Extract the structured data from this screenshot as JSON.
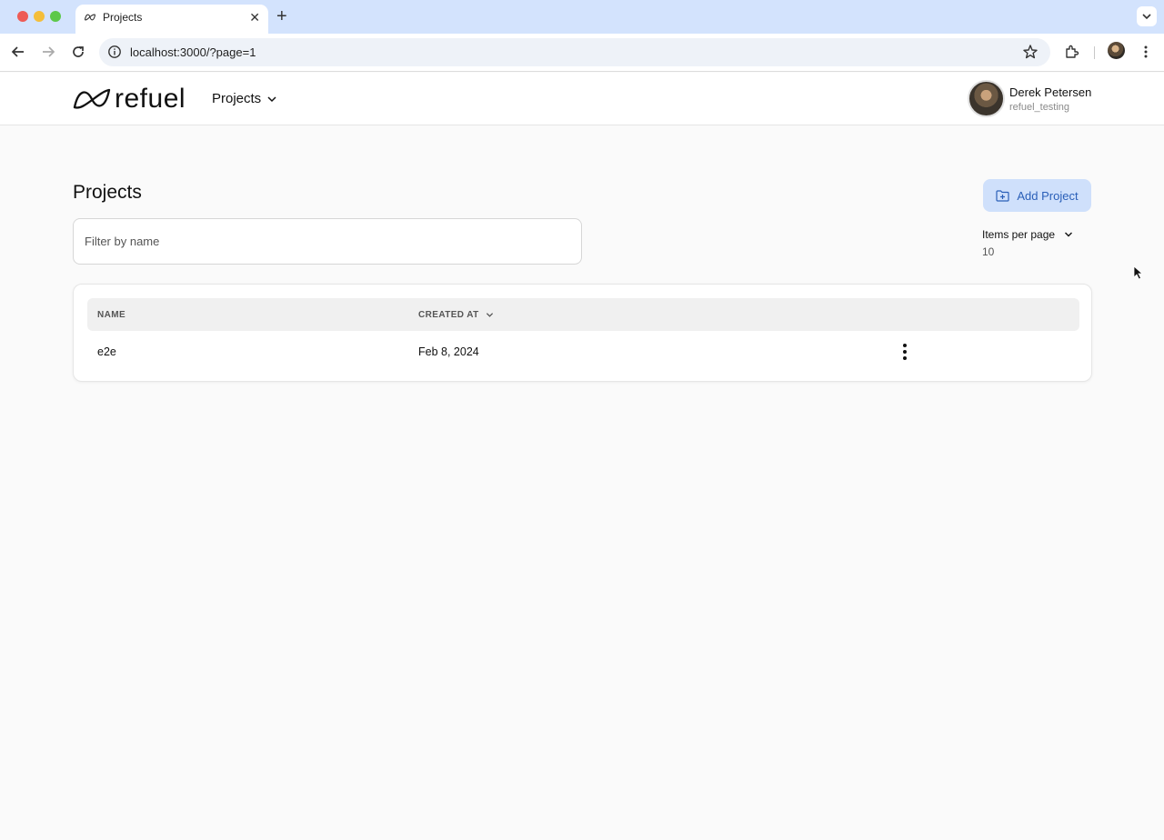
{
  "browser": {
    "tab_title": "Projects",
    "url": "localhost:3000/?page=1"
  },
  "header": {
    "logo_text": "refuel",
    "nav_menu_label": "Projects",
    "user": {
      "name": "Derek Petersen",
      "handle": "refuel_testing"
    }
  },
  "page": {
    "title": "Projects",
    "add_project_label": "Add Project",
    "filter_placeholder": "Filter by name",
    "items_per_page_label": "Items per page",
    "items_per_page_value": "10"
  },
  "table": {
    "columns": [
      "NAME",
      "CREATED AT"
    ],
    "rows": [
      {
        "name": "e2e",
        "created_at": "Feb 8, 2024"
      }
    ]
  },
  "colors": {
    "accent": "#2a5fb8",
    "accent_bg": "#cfe0fb",
    "tabbar_bg": "#d3e3fd"
  }
}
